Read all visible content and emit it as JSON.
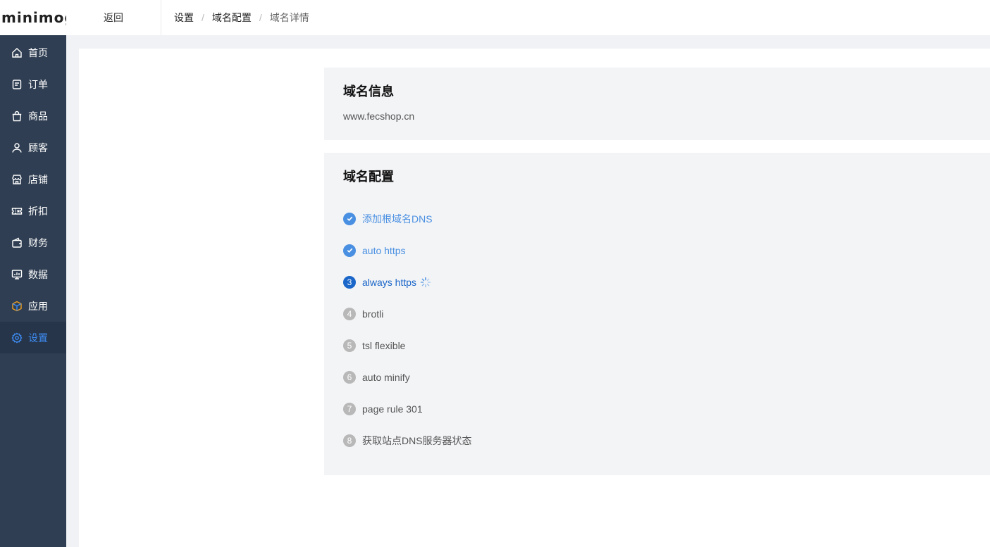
{
  "app": {
    "logo": "minimog"
  },
  "sidebar": {
    "items": [
      {
        "label": "首页",
        "icon": "home-icon"
      },
      {
        "label": "订单",
        "icon": "order-icon"
      },
      {
        "label": "商品",
        "icon": "shopping-bag-icon"
      },
      {
        "label": "顾客",
        "icon": "user-icon"
      },
      {
        "label": "店铺",
        "icon": "store-icon"
      },
      {
        "label": "折扣",
        "icon": "ticket-icon"
      },
      {
        "label": "财务",
        "icon": "wallet-icon"
      },
      {
        "label": "数据",
        "icon": "monitor-chart-icon"
      },
      {
        "label": "应用",
        "icon": "cube-icon"
      },
      {
        "label": "设置",
        "icon": "gear-icon",
        "active": true
      }
    ]
  },
  "header": {
    "back_label": "返回",
    "breadcrumb": [
      "设置",
      "域名配置",
      "域名详情"
    ]
  },
  "domain_info": {
    "title": "域名信息",
    "domain": "www.fecshop.cn"
  },
  "domain_config": {
    "title": "域名配置",
    "steps": [
      {
        "num": "1",
        "label": "添加根域名DNS",
        "status": "done"
      },
      {
        "num": "2",
        "label": "auto https",
        "status": "done"
      },
      {
        "num": "3",
        "label": "always https",
        "status": "active"
      },
      {
        "num": "4",
        "label": "brotli",
        "status": "pending"
      },
      {
        "num": "5",
        "label": "tsl flexible",
        "status": "pending"
      },
      {
        "num": "6",
        "label": "auto minify",
        "status": "pending"
      },
      {
        "num": "7",
        "label": "page rule 301",
        "status": "pending"
      },
      {
        "num": "8",
        "label": "获取站点DNS服务器状态",
        "status": "pending"
      }
    ]
  },
  "colors": {
    "sidebar_bg": "#2f3e52",
    "sidebar_active_bg": "#26354a",
    "accent": "#3d8bf2",
    "step_done": "#4a90e2",
    "step_active": "#1a66c9",
    "step_pending": "#b8b8b8",
    "app_icon_orange": "#f0a020"
  }
}
